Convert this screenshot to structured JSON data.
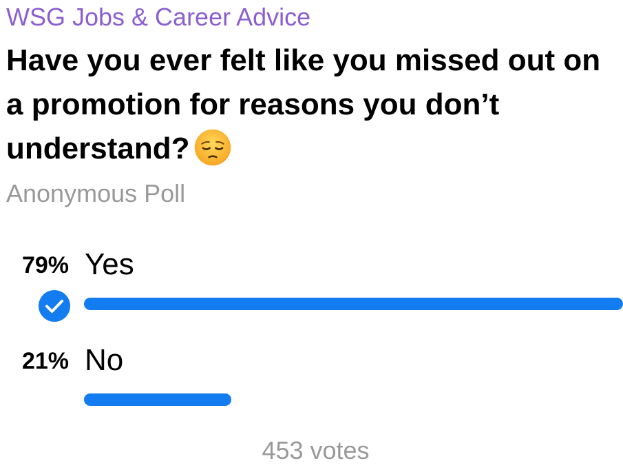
{
  "colors": {
    "accent": "#8c5fd0",
    "bar": "#137cf0",
    "muted": "#999999"
  },
  "poll": {
    "channel": "WSG Jobs & Career Advice",
    "question": "Have you ever felt like you missed out on a promotion for reasons you don’t understand?",
    "question_emoji": "pensive-face",
    "type_label": "Anonymous Poll",
    "options": [
      {
        "percent_label": "79%",
        "text": "Yes",
        "fraction": 1.0,
        "chosen": true,
        "check_icon": "checkmark-circle-icon"
      },
      {
        "percent_label": "21%",
        "text": "No",
        "fraction": 0.2732,
        "chosen": false
      }
    ],
    "votes_label": "453 votes"
  }
}
